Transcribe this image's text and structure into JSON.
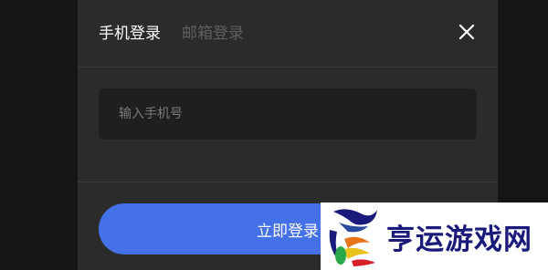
{
  "dialog": {
    "tabs": [
      {
        "label": "手机登录",
        "active": true
      },
      {
        "label": "邮箱登录",
        "active": false
      }
    ],
    "close_icon": "close-icon",
    "phone_input": {
      "value": "",
      "placeholder": "输入手机号"
    },
    "login_button_label": "立即登录"
  },
  "watermark": {
    "text": "亨运游戏网",
    "logo_icon": "dragon-logo"
  },
  "colors": {
    "backdrop": "#151515",
    "dialog_bg": "#2b2b2b",
    "input_bg": "#1f1f1f",
    "active_tab": "#ffffff",
    "inactive_tab": "#5f5f5f",
    "accent": "#4470e8",
    "watermark_text": "#1a1a7a"
  }
}
